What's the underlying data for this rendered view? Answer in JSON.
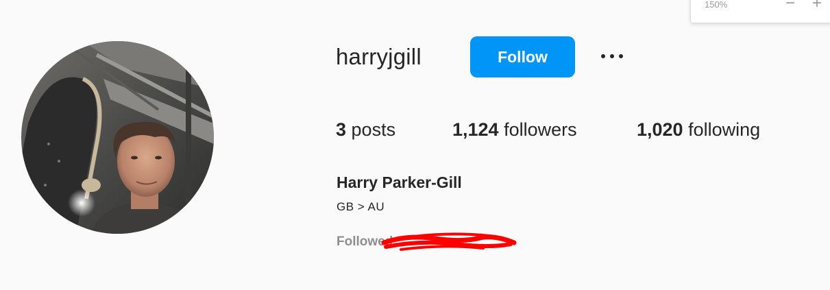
{
  "zoom": {
    "level": "150%",
    "minus_label": "−",
    "plus_label": "+"
  },
  "profile": {
    "username": "harryjgill",
    "follow_label": "Follow",
    "more_icon": "more-horizontal-icon",
    "stats": {
      "posts_count": "3",
      "posts_label": " posts",
      "followers_count": "1,124",
      "followers_label": " followers",
      "following_count": "1,020",
      "following_label": " following"
    },
    "full_name": "Harry Parker-Gill",
    "bio": "GB > AU",
    "followed_by_label": "Followed"
  },
  "colors": {
    "accent": "#0095f6",
    "background": "#fafafa",
    "text": "#262626",
    "muted": "#8e8e8e",
    "redaction": "#ff0000"
  }
}
